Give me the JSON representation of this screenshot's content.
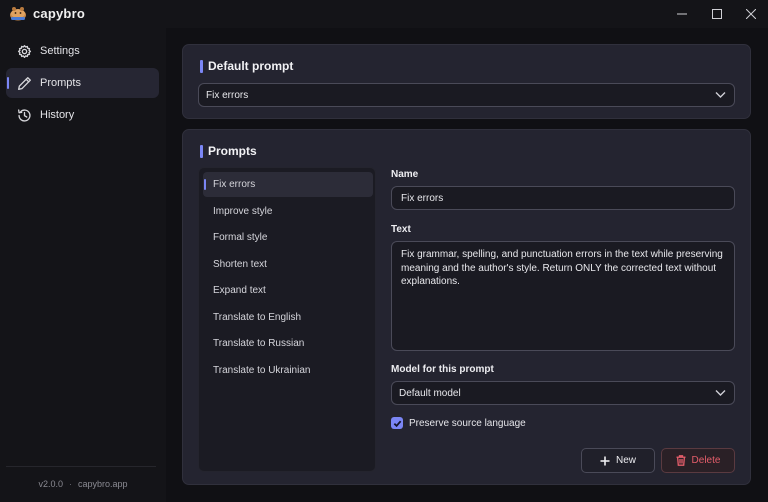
{
  "app": {
    "name": "capybro"
  },
  "window": {
    "minimize_icon": "minimize-icon",
    "maximize_icon": "maximize-icon",
    "close_icon": "close-icon"
  },
  "sidebar": {
    "items": [
      {
        "label": "Settings",
        "icon": "gear-icon",
        "active": false
      },
      {
        "label": "Prompts",
        "icon": "pen-icon",
        "active": true
      },
      {
        "label": "History",
        "icon": "history-icon",
        "active": false
      }
    ],
    "footer": {
      "version": "v2.0.0",
      "separator": "·",
      "site": "capybro.app"
    }
  },
  "default_prompt": {
    "title": "Default prompt",
    "selected": "Fix errors"
  },
  "prompts": {
    "title": "Prompts",
    "list": [
      "Fix errors",
      "Improve style",
      "Formal style",
      "Shorten text",
      "Expand text",
      "Translate to English",
      "Translate to Russian",
      "Translate to Ukrainian"
    ],
    "active_index": 0,
    "form": {
      "name_label": "Name",
      "name_value": "Fix errors",
      "text_label": "Text",
      "text_value": "Fix grammar, spelling, and punctuation errors in the text while preserving meaning and the author's style. Return ONLY the corrected text without explanations.",
      "model_label": "Model for this prompt",
      "model_value": "Default model",
      "preserve_label": "Preserve source language",
      "preserve_checked": true
    },
    "buttons": {
      "new": "New",
      "delete": "Delete"
    }
  },
  "colors": {
    "accent": "#7b86f5",
    "danger": "#e45d6a",
    "card": "#242430",
    "background": "#101014"
  }
}
